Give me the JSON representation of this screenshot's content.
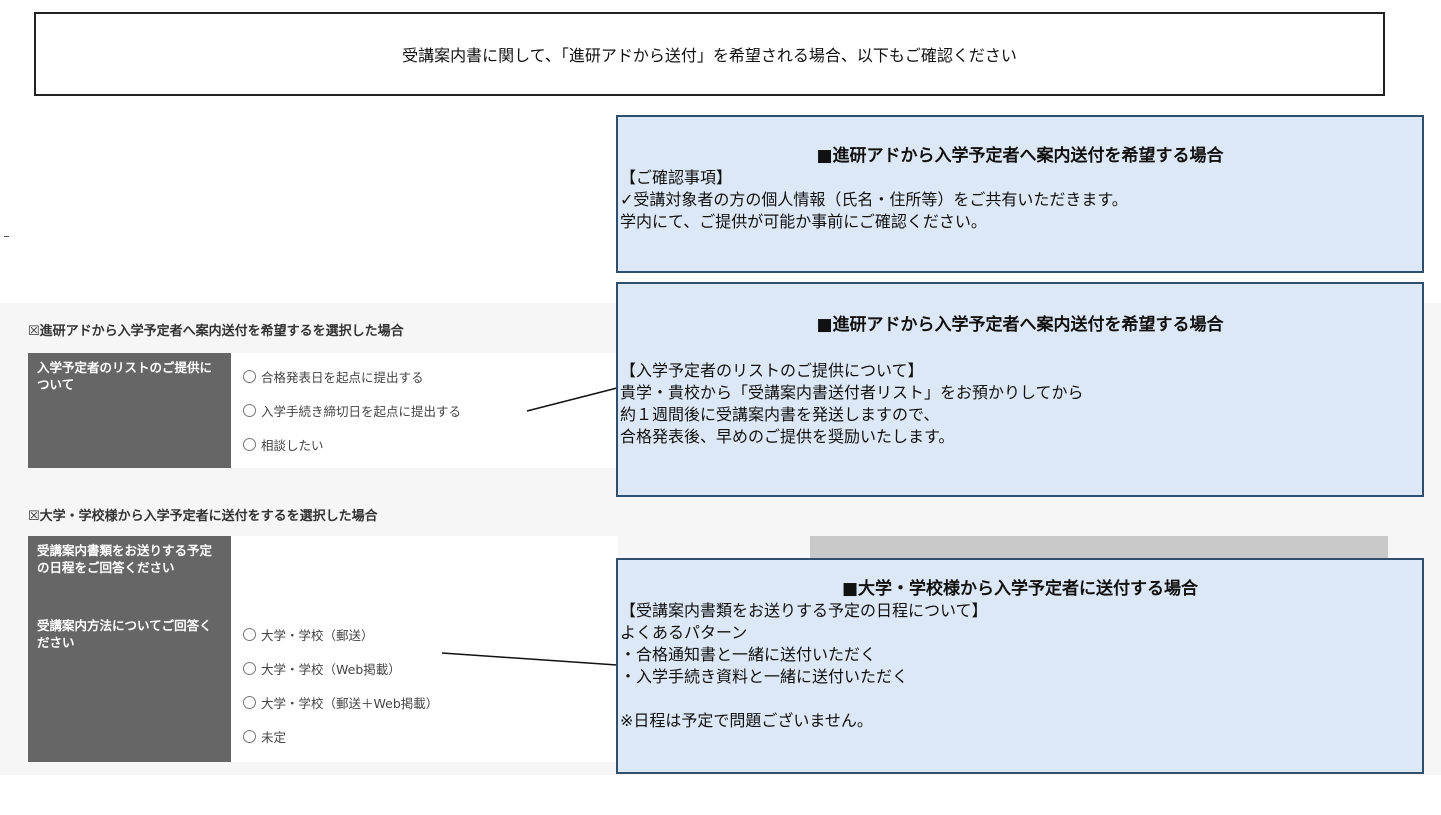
{
  "banner": {
    "text": "受講案内書に関して、「進研アドから送付」を希望される場合、以下もご確認ください"
  },
  "form": {
    "section1": {
      "title": "☒進研アドから入学予定者へ案内送付を希望するを選択した場合",
      "row_label": "入学予定者のリストのご提供について",
      "options": [
        "合格発表日を起点に提出する",
        "入学手続き締切日を起点に提出する",
        "相談したい"
      ]
    },
    "section2": {
      "title": "☒大学・学校様から入学予定者に送付をするを選択した場合",
      "row1_label": "受講案内書類をお送りする予定の日程をご回答ください",
      "row2_label": "受講案内方法についてご回答ください",
      "options": [
        "大学・学校（郵送）",
        "大学・学校（Web掲載）",
        "大学・学校（郵送＋Web掲載）",
        "未定"
      ]
    }
  },
  "callouts": {
    "c1": {
      "title": "■進研アドから入学予定者へ案内送付を希望する場合",
      "lines": [
        "【ご確認事項】",
        "✓受講対象者の方の個人情報（氏名・住所等）をご共有いただきます。",
        "学内にて、ご提供が可能か事前にご確認ください。"
      ]
    },
    "c2": {
      "title": "■進研アドから入学予定者へ案内送付を希望する場合",
      "lines": [
        "【入学予定者のリストのご提供について】",
        "貴学・貴校から「受講案内書送付者リスト」をお預かりしてから",
        "約１週間後に受講案内書を発送しますので、",
        "合格発表後、早めのご提供を奨励いたします。"
      ]
    },
    "c3": {
      "title": "■大学・学校様から入学予定者に送付する場合",
      "lines": [
        "【受講案内書類をお送りする予定の日程について】",
        "よくあるパターン",
        "・合格通知書と一緒に送付いただく",
        "・入学手続き資料と一緒に送付いただく",
        "",
        "※日程は予定で問題ございません。"
      ]
    }
  }
}
